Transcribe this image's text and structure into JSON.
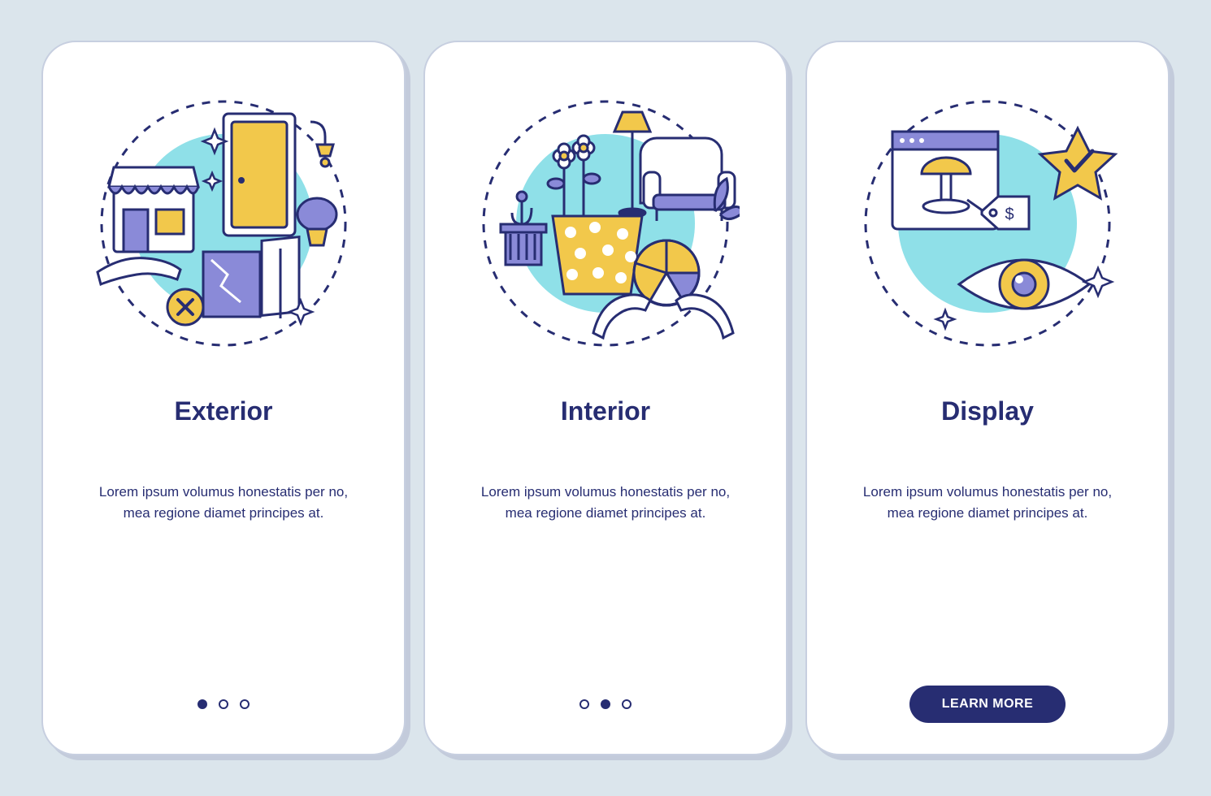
{
  "colors": {
    "navy": "#272d72",
    "purple": "#8a8ad8",
    "cyan": "#8fe0e8",
    "yellow": "#f2c84b",
    "bg": "#dbe5ec"
  },
  "screens": [
    {
      "title": "Exterior",
      "description": "Lorem ipsum volumus honestatis per no, mea regione diamet principes at.",
      "illustration_icon": "exterior-scene",
      "footer_type": "dots",
      "active_dot": 0
    },
    {
      "title": "Interior",
      "description": "Lorem ipsum volumus honestatis per no, mea regione diamet principes at.",
      "illustration_icon": "interior-scene",
      "footer_type": "dots",
      "active_dot": 1
    },
    {
      "title": "Display",
      "description": "Lorem ipsum volumus honestatis per no, mea regione diamet principes at.",
      "illustration_icon": "display-scene",
      "footer_type": "button",
      "button_label": "LEARN MORE"
    }
  ]
}
